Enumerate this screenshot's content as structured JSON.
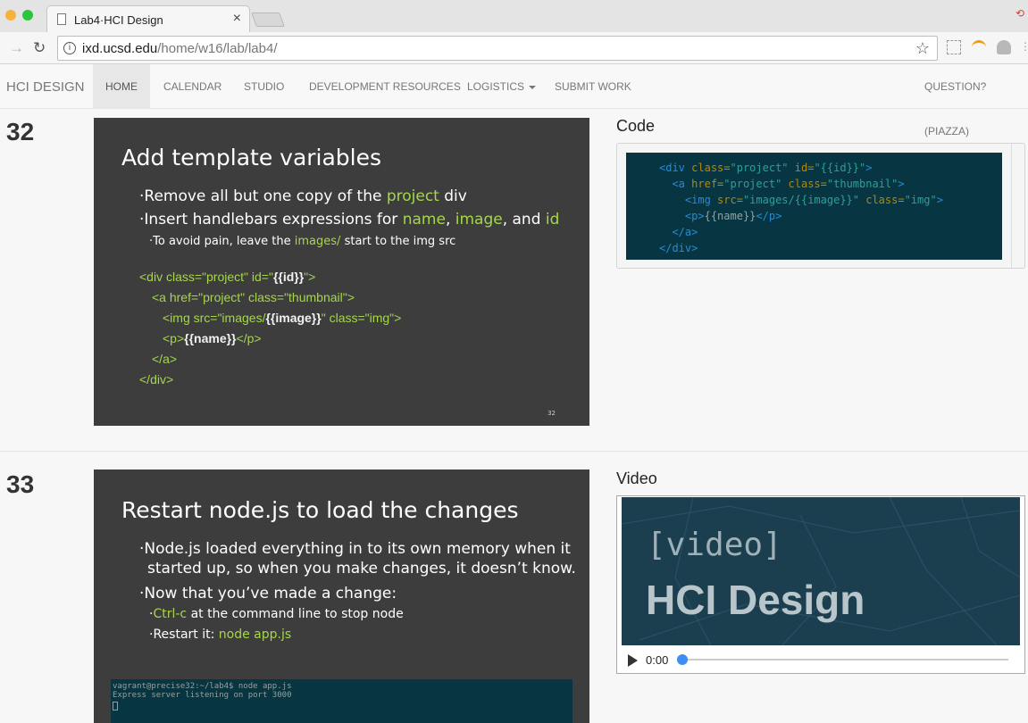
{
  "browser": {
    "tab_title": "Lab4·HCI Design",
    "tab_close": "×",
    "url_host": "ixd.ucsd.edu",
    "url_path": "/home/w16/lab/lab4/"
  },
  "nav": {
    "brand": "HCI DESIGN",
    "items": [
      "HOME",
      "CALENDAR",
      "STUDIO",
      "DEVELOPMENT RESOURCES",
      "LOGISTICS",
      "SUBMIT WORK"
    ],
    "right": "QUESTION? (PIAZZA)"
  },
  "sections": [
    {
      "number": "32",
      "slide": {
        "title": "Add template variables",
        "bullet1_a": "Remove all but one copy of the ",
        "bullet1_g": "project",
        "bullet1_b": " div",
        "bullet2_a": "Insert handlebars expressions for ",
        "bullet2_g1": "name",
        "bullet2_sep1": ", ",
        "bullet2_g2": "image",
        "bullet2_sep2": ", and ",
        "bullet2_g3": "id",
        "sub_a": "To avoid pain, leave the ",
        "sub_g": "images/",
        "sub_b": " start to the img src",
        "code1_a": "<div class=\"project\" id=\"",
        "code1_b": "{{id}}",
        "code1_c": "\">",
        "code2": "<a href=\"project\" class=\"thumbnail\">",
        "code3_a": "<img src=\"images/",
        "code3_b": "{{image}}",
        "code3_c": "\" class=\"img\">",
        "code4_a": "<p>",
        "code4_b": "{{name}}",
        "code4_c": "</p>",
        "code5": "</a>",
        "code6": "</div>",
        "page": "32"
      },
      "side_title": "Code"
    },
    {
      "number": "33",
      "slide": {
        "title": "Restart node.js to load the changes",
        "bullet1": "Node.js loaded everything in to its own memory when it",
        "bullet1_cont": "started up, so when you make changes, it doesn’t know.",
        "bullet2": "Now that you’ve made a change:",
        "sub1_g": "Ctrl-c",
        "sub1_b": " at the command line to stop node",
        "sub2_a": "Restart it: ",
        "sub2_g": "node app.js",
        "terminal1": "vagrant@precise32:~/lab4$ node app.js",
        "terminal2": "Express server listening on port 3000"
      },
      "side_title": "Video"
    }
  ],
  "video": {
    "title_line1": "[video]",
    "title_line2": "HCI Design",
    "time": "0:00"
  },
  "colors": {
    "accent_green": "#a5d64b",
    "code_bg": "#073642",
    "progress": "#3e8ef0"
  }
}
